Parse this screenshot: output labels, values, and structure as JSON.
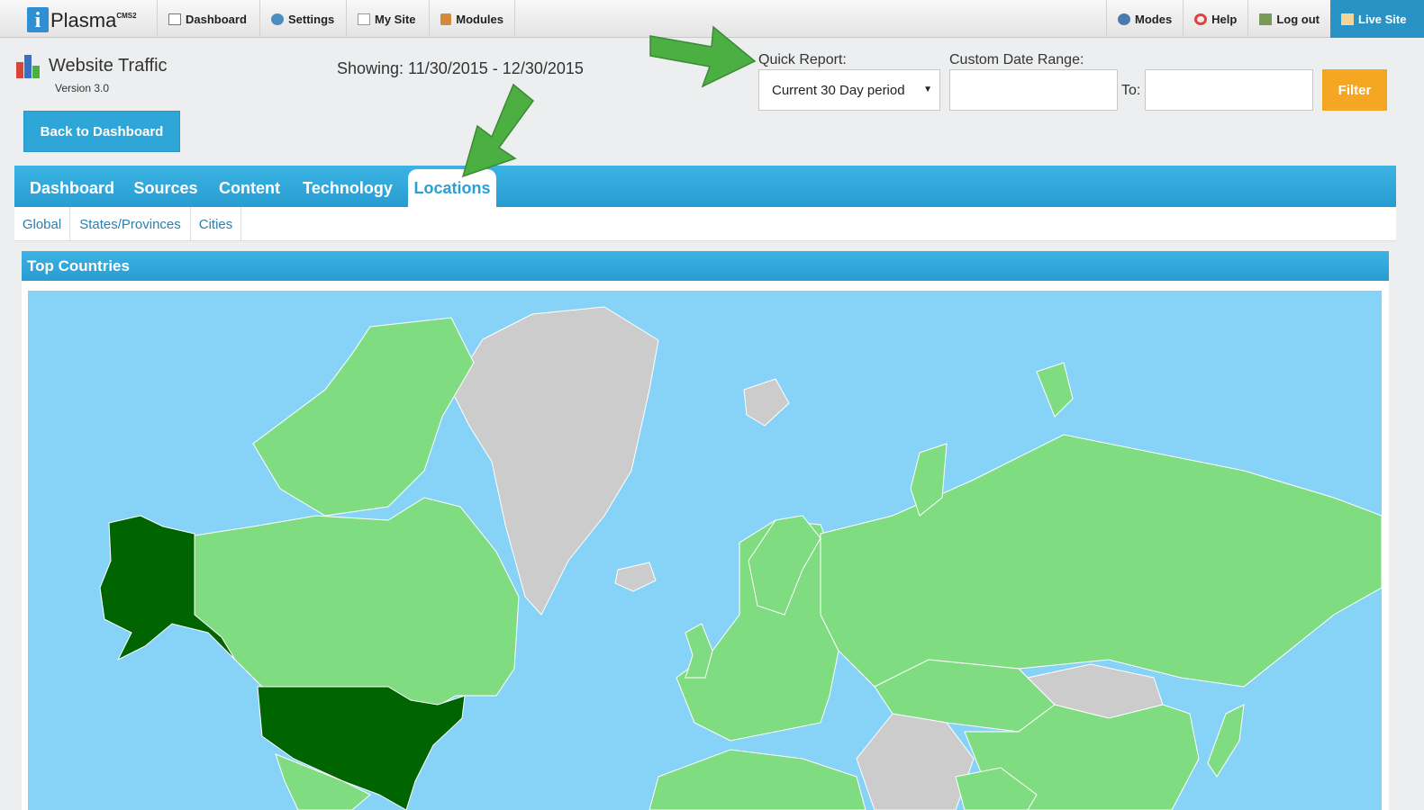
{
  "topbar": {
    "brand": {
      "name": "Plasma",
      "sup": "CMS2"
    },
    "left_nav": [
      {
        "label": "Dashboard",
        "icon": "dashboard-icon"
      },
      {
        "label": "Settings",
        "icon": "gear-icon"
      },
      {
        "label": "My Site",
        "icon": "pencil-icon"
      },
      {
        "label": "Modules",
        "icon": "box-icon"
      }
    ],
    "right_nav": [
      {
        "label": "Modes",
        "icon": "modes-icon"
      },
      {
        "label": "Help",
        "icon": "lifebuoy-icon"
      },
      {
        "label": "Log out",
        "icon": "logout-icon"
      },
      {
        "label": "Live Site",
        "icon": "home-icon"
      }
    ]
  },
  "header": {
    "title": "Website Traffic",
    "version": "Version 3.0",
    "showing": "Showing: 11/30/2015 - 12/30/2015",
    "back_button": "Back to Dashboard"
  },
  "report": {
    "quick_label": "Quick Report:",
    "quick_value": "Current 30 Day period",
    "custom_label": "Custom Date Range:",
    "from_value": "",
    "to_label": "To:",
    "to_value": "",
    "filter_button": "Filter"
  },
  "tabs": [
    {
      "label": "Dashboard",
      "active": false
    },
    {
      "label": "Sources",
      "active": false
    },
    {
      "label": "Content",
      "active": false
    },
    {
      "label": "Technology",
      "active": false
    },
    {
      "label": "Locations",
      "active": true
    }
  ],
  "subtabs": [
    {
      "label": "Global"
    },
    {
      "label": "States/Provinces"
    },
    {
      "label": "Cities"
    }
  ],
  "panel": {
    "title": "Top Countries"
  },
  "colors": {
    "accent_blue": "#2ea6d8",
    "filter_orange": "#f5a623",
    "ocean": "#87d3f7",
    "country_high": "#006400",
    "country_low": "#80dc80",
    "country_none": "#cccccc",
    "annotation_arrow": "#4caf42"
  }
}
